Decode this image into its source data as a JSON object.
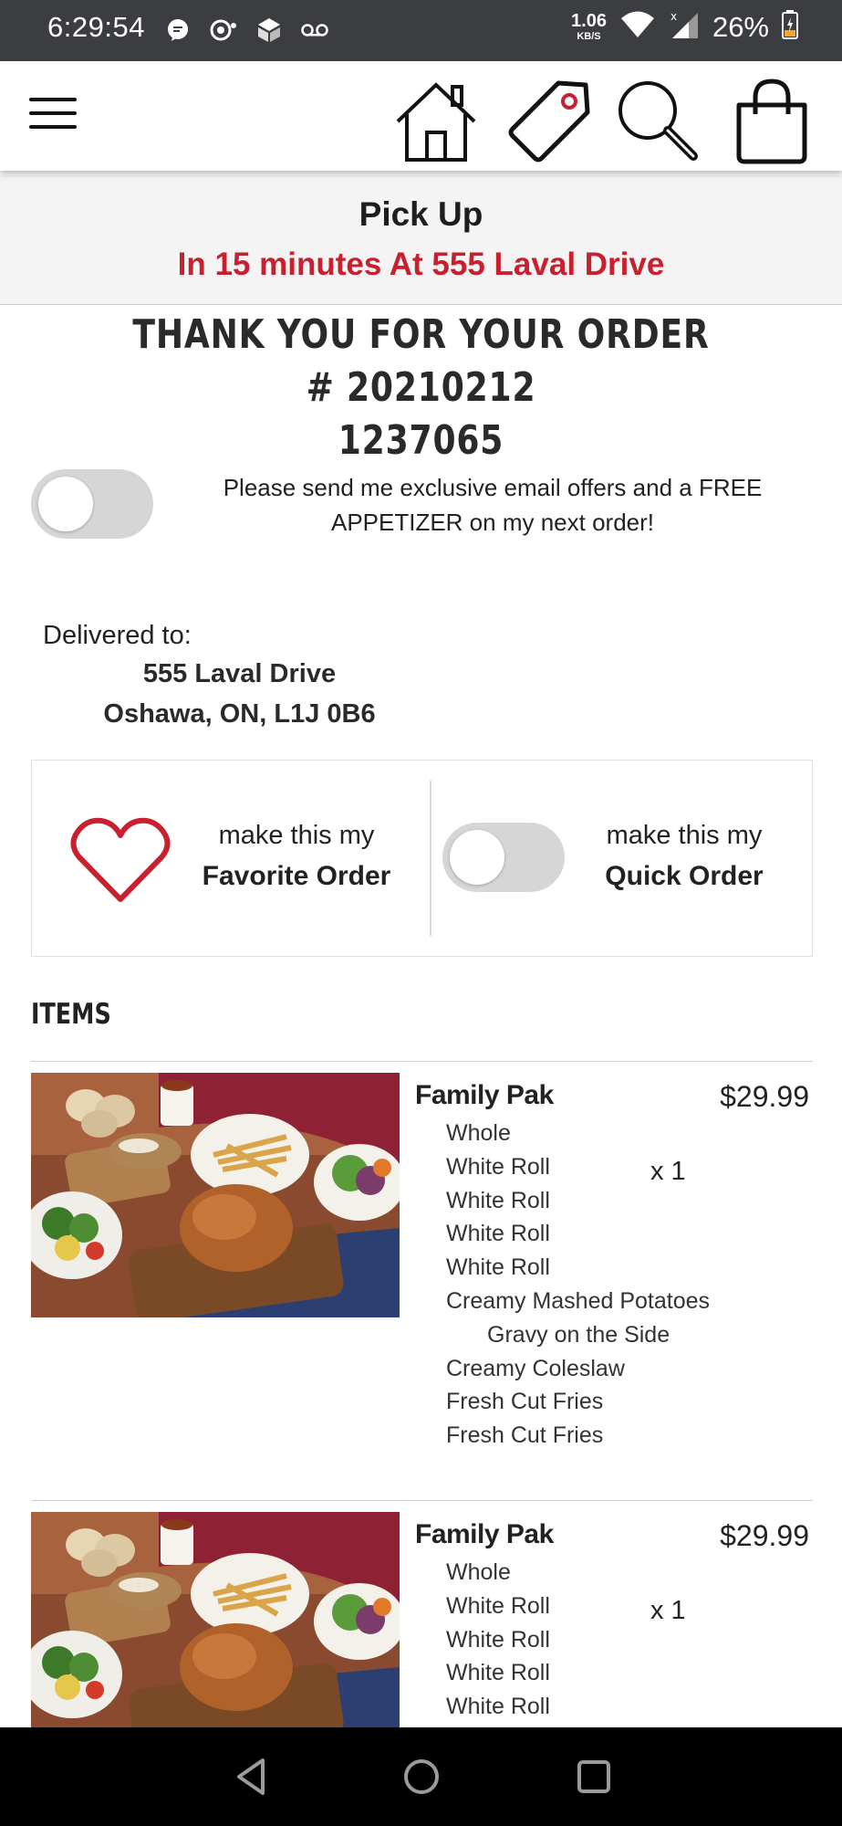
{
  "status_bar": {
    "time": "6:29:54",
    "net_speed_value": "1.06",
    "net_speed_unit": "KB/S",
    "battery_percent": "26%",
    "icons": [
      "message-notification-icon",
      "podcast-notification-icon",
      "app-notification-icon",
      "voicemail-icon",
      "wifi-icon",
      "cell-signal-icon",
      "battery-charging-icon"
    ]
  },
  "header": {
    "icons": [
      "menu-icon",
      "home-icon",
      "offers-tag-icon",
      "search-icon",
      "shopping-bag-icon"
    ],
    "accent_color": "#c8202e"
  },
  "pickup": {
    "title": "Pick Up",
    "subtitle": "In 15 minutes At 555 Laval Drive"
  },
  "order": {
    "thank_you_line1": "THANK YOU FOR YOUR ORDER # 20210212",
    "thank_you_line2": "1237065"
  },
  "email_optin": {
    "enabled": false,
    "text": "Please send me exclusive email offers and a FREE APPETIZER on my next order!"
  },
  "delivery": {
    "label": "Delivered to:",
    "address_line1": "555 Laval Drive",
    "address_line2": "Oshawa, ON, L1J 0B6"
  },
  "favorite": {
    "line1": "make this my",
    "line2": "Favorite Order"
  },
  "quick_order": {
    "enabled": false,
    "line1": "make this my",
    "line2": "Quick Order"
  },
  "items_heading": "ITEMS",
  "items": [
    {
      "name": "Family Pak",
      "price": "$29.99",
      "quantity": "x 1",
      "modifiers": [
        {
          "text": "Whole",
          "indent": false
        },
        {
          "text": "White Roll",
          "indent": false
        },
        {
          "text": "White Roll",
          "indent": false
        },
        {
          "text": "White Roll",
          "indent": false
        },
        {
          "text": "White Roll",
          "indent": false
        },
        {
          "text": "Creamy Mashed Potatoes",
          "indent": false
        },
        {
          "text": "Gravy on the Side",
          "indent": true
        },
        {
          "text": "Creamy Coleslaw",
          "indent": false
        },
        {
          "text": "Fresh Cut Fries",
          "indent": false
        },
        {
          "text": "Fresh Cut Fries",
          "indent": false
        }
      ]
    },
    {
      "name": "Family Pak",
      "price": "$29.99",
      "quantity": "x 1",
      "modifiers": [
        {
          "text": "Whole",
          "indent": false
        },
        {
          "text": "White Roll",
          "indent": false
        },
        {
          "text": "White Roll",
          "indent": false
        },
        {
          "text": "White Roll",
          "indent": false
        },
        {
          "text": "White Roll",
          "indent": false
        }
      ]
    }
  ],
  "system_nav": [
    "back-icon",
    "home-circle-icon",
    "recents-icon"
  ]
}
